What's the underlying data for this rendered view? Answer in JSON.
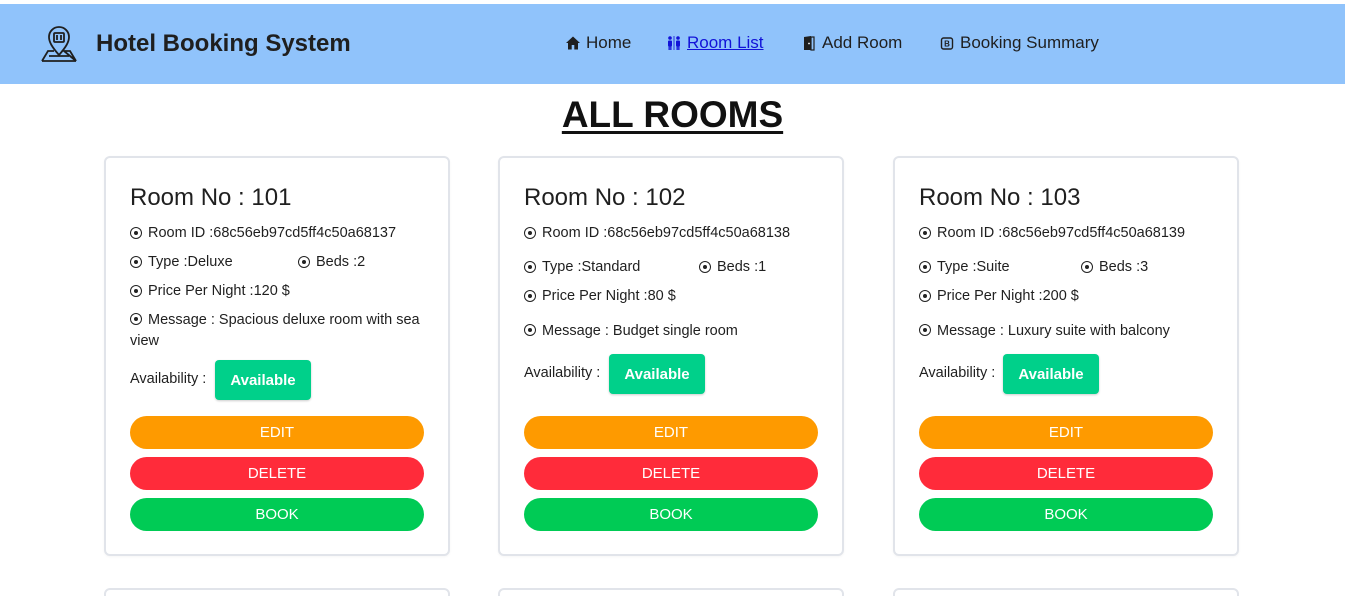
{
  "nav": {
    "brand": "Hotel Booking System",
    "items": [
      {
        "label": "Home",
        "icon": "home-icon"
      },
      {
        "label": "Room List",
        "icon": "people-icon"
      },
      {
        "label": "Add Room",
        "icon": "door-icon"
      },
      {
        "label": "Booking Summary",
        "icon": "receipt-icon"
      }
    ],
    "active_item": "Room List",
    "bg_color": "#90c3fb",
    "active_color": "#1212d8"
  },
  "heading": "ALL ROOMS",
  "labels": {
    "room_no": "Room No : ",
    "room_id": "Room ID : ",
    "type": "Type : ",
    "beds": "Beds : ",
    "price": "Price Per Night : ",
    "message": "Message : ",
    "availability": "Availability : ",
    "edit": "EDIT",
    "delete": "DELETE",
    "book": "BOOK"
  },
  "rooms": [
    {
      "room_no": "101",
      "room_id": "68c56eb97cd5ff4c50a68137",
      "type": "Deluxe",
      "beds": "2",
      "price": "120 $",
      "message": "Spacious deluxe room with sea view",
      "availability": "Available"
    },
    {
      "room_no": "102",
      "room_id": "68c56eb97cd5ff4c50a68138",
      "type": "Standard",
      "beds": "1",
      "price": "80 $",
      "message": "Budget single room",
      "availability": "Available"
    },
    {
      "room_no": "103",
      "room_id": "68c56eb97cd5ff4c50a68139",
      "type": "Suite",
      "beds": "3",
      "price": "200 $",
      "message": "Luxury suite with balcony",
      "availability": "Available"
    }
  ],
  "colors": {
    "available": "#00d08a",
    "edit": "#fe9a00",
    "delete": "#ff2b3a",
    "book": "#00cb55"
  }
}
